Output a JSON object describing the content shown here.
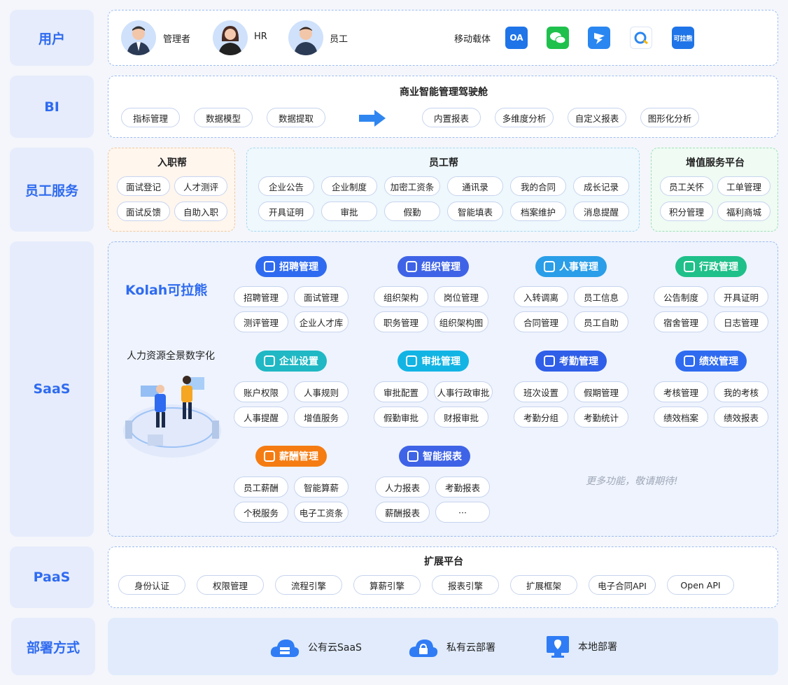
{
  "labels": {
    "user": "用户",
    "bi": "BI",
    "employee": "员工服务",
    "saas": "SaaS",
    "paas": "PaaS",
    "deploy": "部署方式"
  },
  "users": {
    "admin": "管理者",
    "hr": "HR",
    "staff": "员工",
    "mobile": "移动载体",
    "oa": "OA",
    "kolah_icon": "可拉熊"
  },
  "bi": {
    "title": "商业智能管理驾驶舱",
    "left": [
      "指标管理",
      "数据模型",
      "数据提取"
    ],
    "right": [
      "内置报表",
      "多维度分析",
      "自定义报表",
      "图形化分析"
    ]
  },
  "employee": {
    "onboard": {
      "title": "入职帮",
      "items": [
        "面试登记",
        "人才测评",
        "面试反馈",
        "自助入职"
      ]
    },
    "helper": {
      "title": "员工帮",
      "items": [
        "企业公告",
        "企业制度",
        "加密工资条",
        "通讯录",
        "我的合同",
        "成长记录",
        "开具证明",
        "审批",
        "假勤",
        "智能填表",
        "档案维护",
        "消息提醒"
      ]
    },
    "value": {
      "title": "增值服务平台",
      "items": [
        "员工关怀",
        "工单管理",
        "积分管理",
        "福利商城"
      ]
    }
  },
  "saas": {
    "logo": "Kolah可拉熊",
    "slogan": "人力资源全景数字化",
    "more": "更多功能，敬请期待!",
    "modules": [
      {
        "name": "招聘管理",
        "color": "#2f6bf0",
        "items": [
          "招聘管理",
          "面试管理",
          "测评管理",
          "企业人才库"
        ]
      },
      {
        "name": "组织管理",
        "color": "#3f63e6",
        "items": [
          "组织架构",
          "岗位管理",
          "职务管理",
          "组织架构图"
        ]
      },
      {
        "name": "人事管理",
        "color": "#2a9ee8",
        "items": [
          "入转调离",
          "员工信息",
          "合同管理",
          "员工自助"
        ]
      },
      {
        "name": "行政管理",
        "color": "#1fc08a",
        "items": [
          "公告制度",
          "开具证明",
          "宿舍管理",
          "日志管理"
        ]
      },
      {
        "name": "企业设置",
        "color": "#1fb8c4",
        "items": [
          "账户权限",
          "人事规则",
          "人事提醒",
          "增值服务"
        ]
      },
      {
        "name": "审批管理",
        "color": "#12b4e4",
        "items": [
          "审批配置",
          "人事行政审批",
          "假勤审批",
          "财报审批"
        ]
      },
      {
        "name": "考勤管理",
        "color": "#2f5ee8",
        "items": [
          "班次设置",
          "假期管理",
          "考勤分组",
          "考勤统计"
        ]
      },
      {
        "name": "绩效管理",
        "color": "#2f6bf0",
        "items": [
          "考核管理",
          "我的考核",
          "绩效档案",
          "绩效报表"
        ]
      },
      {
        "name": "薪酬管理",
        "color": "#f57c12",
        "items": [
          "员工薪酬",
          "智能算薪",
          "个税服务",
          "电子工资条"
        ]
      },
      {
        "name": "智能报表",
        "color": "#3f63e6",
        "items": [
          "人力报表",
          "考勤报表",
          "薪酬报表",
          "···"
        ]
      }
    ]
  },
  "paas": {
    "title": "扩展平台",
    "items": [
      "身份认证",
      "权限管理",
      "流程引擎",
      "算薪引擎",
      "报表引擎",
      "扩展框架",
      "电子合同API",
      "Open API"
    ]
  },
  "deploy": {
    "items": [
      "公有云SaaS",
      "私有云部署",
      "本地部署"
    ]
  },
  "colors": {
    "primary": "#2f6bf0",
    "label_bg": "#e6ecfb"
  }
}
